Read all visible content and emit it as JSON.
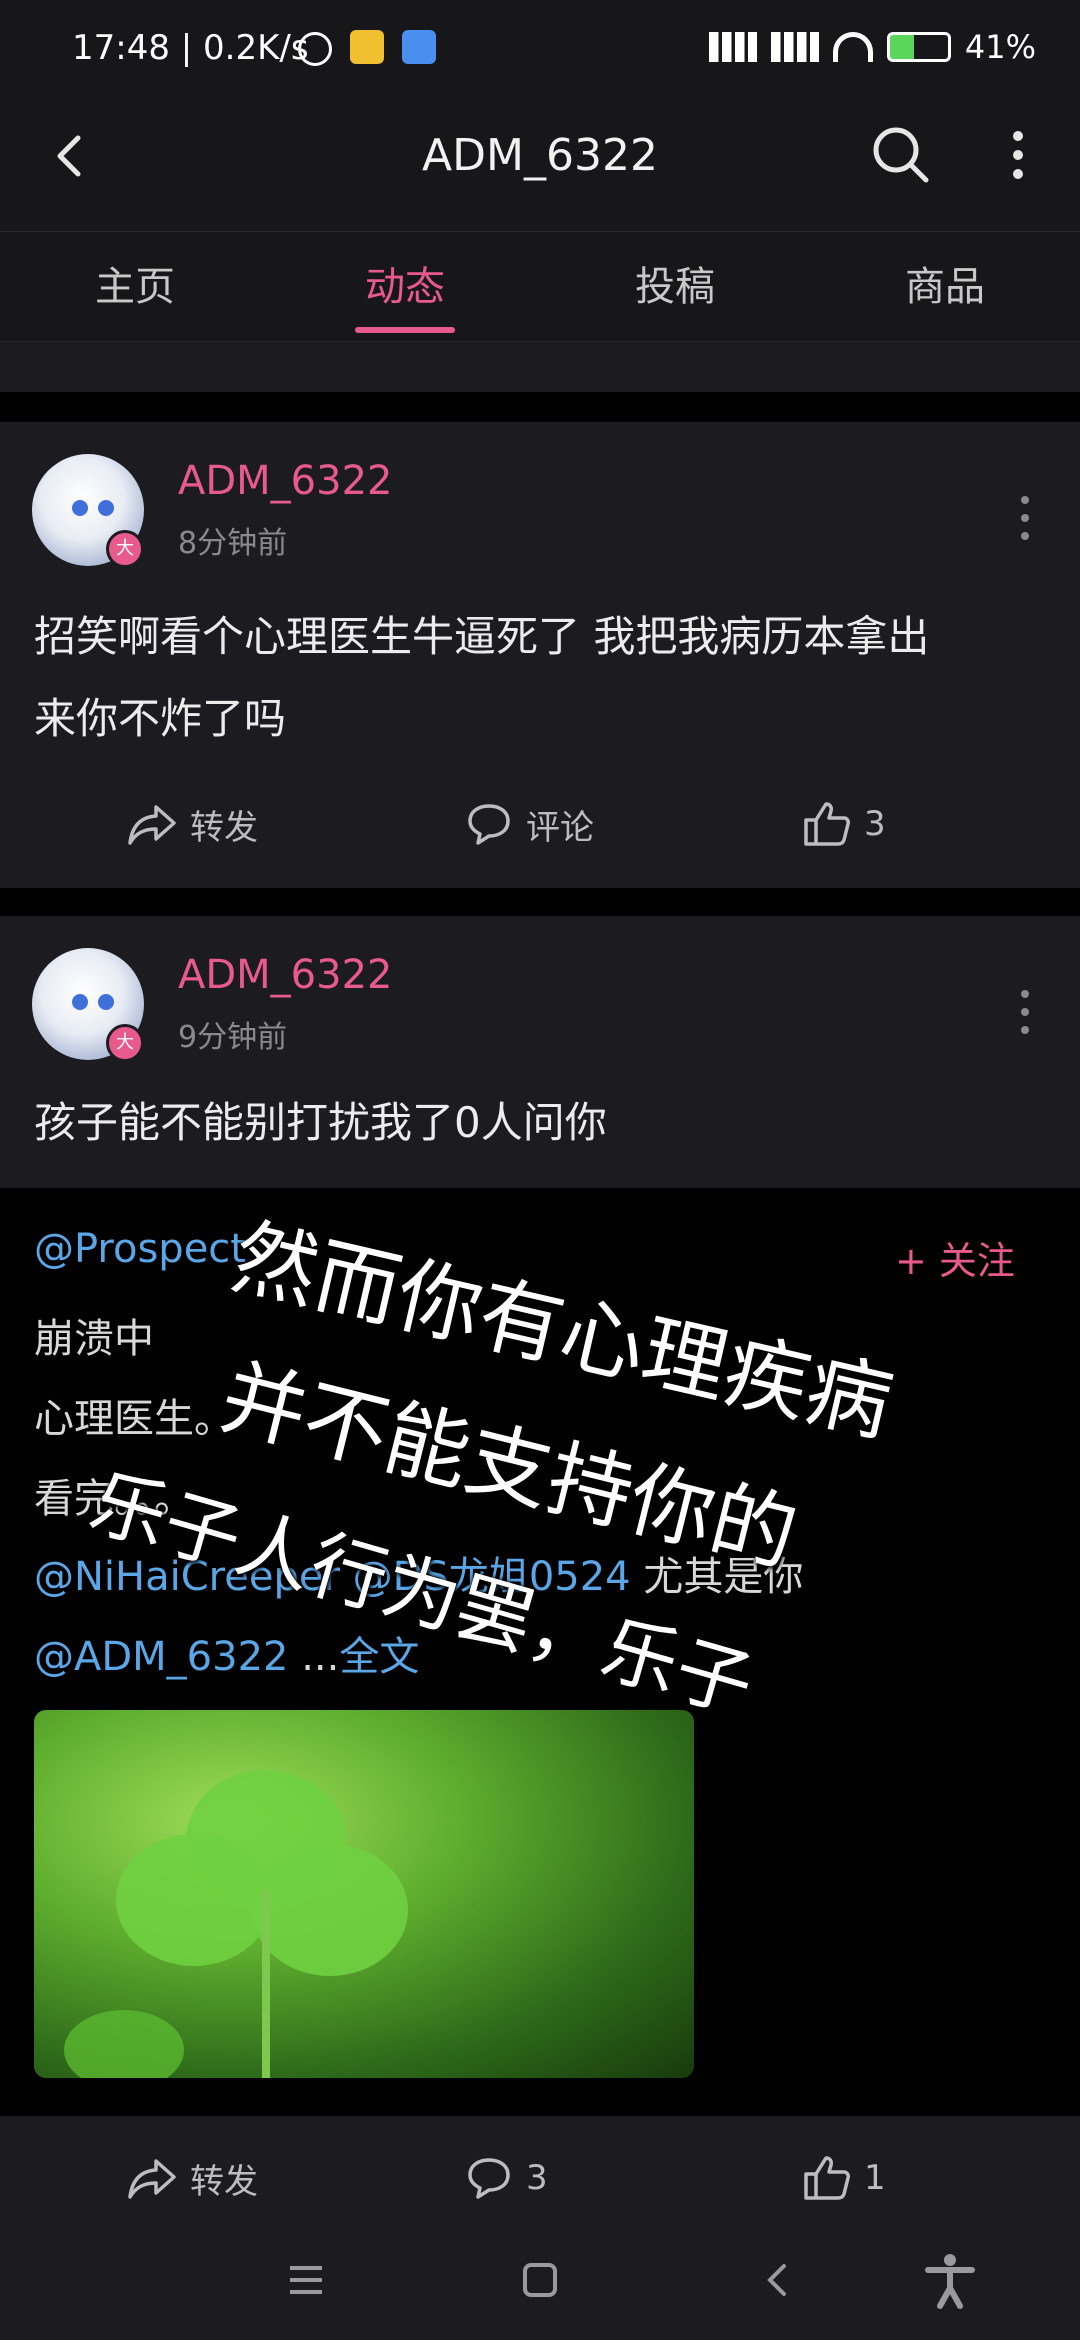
{
  "status_bar": {
    "time": "17:48 | 0.2K/s",
    "battery": "41%"
  },
  "header": {
    "title": "ADM_6322",
    "back_icon": "chevron-left-icon",
    "search_icon": "search-icon",
    "more_icon": "more-vertical-icon"
  },
  "tabs": [
    {
      "label": "主页",
      "active": false
    },
    {
      "label": "动态",
      "active": true
    },
    {
      "label": "投稿",
      "active": false
    },
    {
      "label": "商品",
      "active": false
    }
  ],
  "posts": [
    {
      "username": "ADM_6322",
      "time": "8分钟前",
      "badge": "大",
      "content_line1": "招笑啊看个心理医生牛逼死了 我把我病历本拿出",
      "content_line2": "来你不炸了吗",
      "actions": {
        "share": "转发",
        "comment": "评论",
        "like": "3"
      }
    },
    {
      "username": "ADM_6322",
      "time": "9分钟前",
      "badge": "大",
      "content": "孩子能不能别打扰我了0人问你",
      "repost": {
        "author_mention": "@Prospect",
        "follow_label": "+ 关注",
        "line1": "崩溃中",
        "line2": "心理医生。",
        "line3": "看完。。。",
        "line4_mention1": "@NiHaiCreeper",
        "line4_mention2": "@DS龙姐0524",
        "line4_text": "尤其是你",
        "line5_mention": "@ADM_6322",
        "line5_ellipsis": " ...",
        "line5_more": "全文"
      },
      "overlay": {
        "line1": "然而你有心理疾病",
        "line2": "并不能支持你的",
        "line3": "乐子人行为罢，乐子"
      },
      "actions": {
        "share": "转发",
        "comment": "3",
        "like": "1"
      }
    }
  ],
  "colors": {
    "accent": "#e85a8c",
    "link": "#5aa6e6",
    "background": "#000000",
    "card": "#1c1c20"
  }
}
